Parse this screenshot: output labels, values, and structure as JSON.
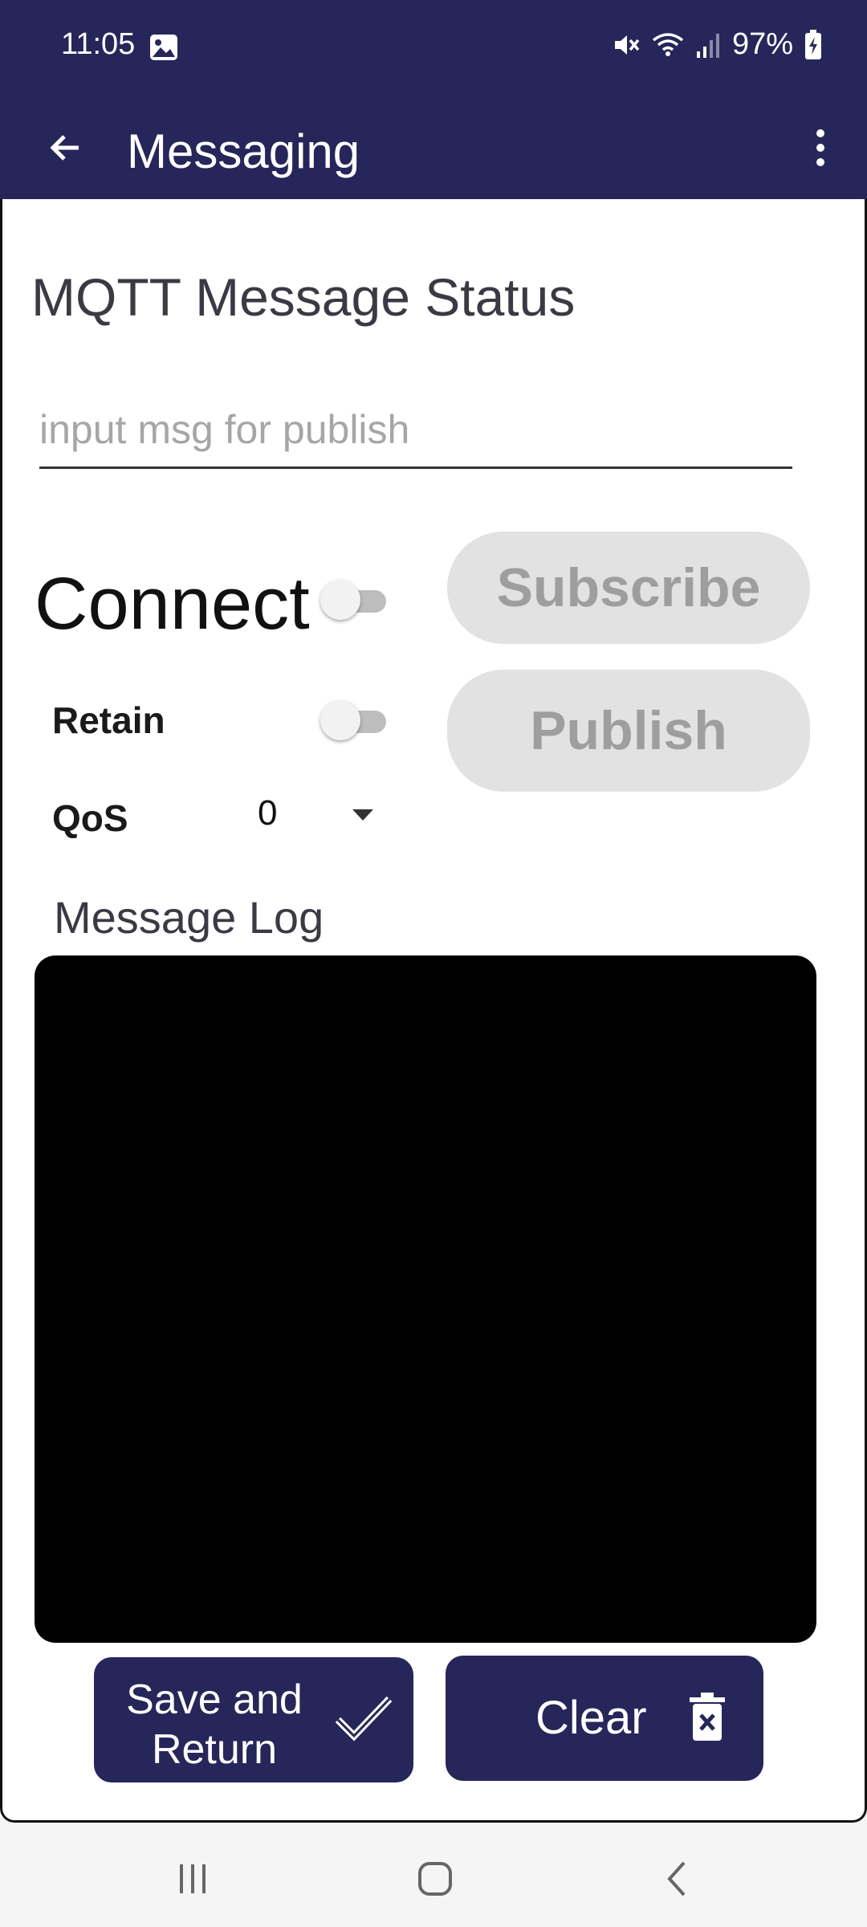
{
  "status_bar": {
    "time": "11:05",
    "battery": "97%",
    "icons": [
      "gallery-icon",
      "mute-icon",
      "wifi-icon",
      "signal-icon",
      "battery-charging-icon"
    ]
  },
  "app_bar": {
    "title": "Messaging",
    "back_icon": "arrow-back-icon",
    "menu_icon": "overflow-menu-icon"
  },
  "main": {
    "heading": "MQTT Message Status",
    "message_input": {
      "placeholder": "input msg for publish",
      "value": ""
    },
    "connect": {
      "label": "Connect",
      "on": false
    },
    "retain": {
      "label": "Retain",
      "on": false
    },
    "qos": {
      "label": "QoS",
      "value": "0"
    },
    "subscribe_label": "Subscribe",
    "publish_label": "Publish",
    "log_label": "Message Log",
    "log_content": "",
    "save_label_line1": "Save and",
    "save_label_line2": "Return",
    "clear_label": "Clear"
  },
  "nav_bar": {
    "icons": [
      "recents-icon",
      "home-icon",
      "back-icon"
    ]
  },
  "colors": {
    "primary": "#27265a",
    "disabled_button_bg": "#e2e2e2",
    "disabled_button_text": "#9e9e9e",
    "log_background": "#000000"
  }
}
